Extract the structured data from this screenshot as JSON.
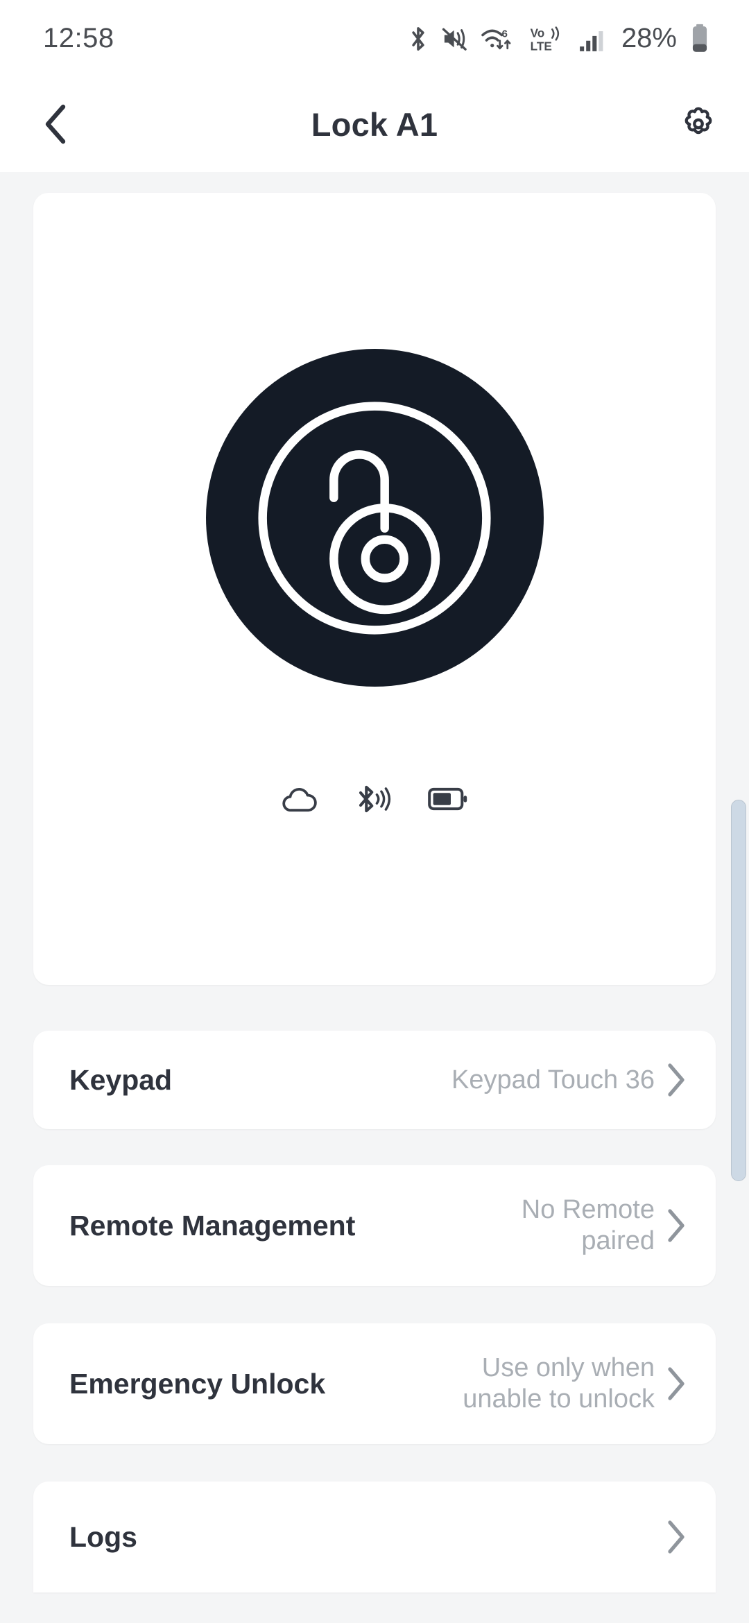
{
  "status_bar": {
    "time": "12:58",
    "battery_percent": "28%",
    "icons": [
      "bluetooth-icon",
      "mute-vibrate-icon",
      "wifi-6-data-icon",
      "volte-icon",
      "cellular-signal-icon",
      "battery-icon"
    ],
    "wifi_generation": "6",
    "network_label_top": "Vo))",
    "network_label_bottom": "LTE"
  },
  "header": {
    "back_icon": "chevron-left-icon",
    "title": "Lock A1",
    "settings_icon": "gear-icon"
  },
  "hero": {
    "lock_state_icon": "unlocked-padlock-icon",
    "circle_color": "#141b26",
    "indicator_icons": [
      "cloud-icon",
      "bluetooth-signal-icon",
      "battery-level-icon"
    ],
    "battery_fill_percent": 70
  },
  "rows": [
    {
      "label": "Keypad",
      "value": "Keypad Touch 36",
      "chevron": "chevron-right-icon"
    },
    {
      "label": "Remote Management",
      "value": "No Remote paired",
      "chevron": "chevron-right-icon"
    },
    {
      "label": "Emergency Unlock",
      "value": "Use only when unable to unlock",
      "chevron": "chevron-right-icon"
    },
    {
      "label": "Logs",
      "value": "",
      "chevron": "chevron-right-icon"
    }
  ],
  "colors": {
    "page_background": "#f4f5f6",
    "card_background": "#ffffff",
    "primary_text": "#2f333d",
    "secondary_text": "#a9aeb4",
    "accent_dark": "#141b26",
    "scrollbar": "#cdd9e5"
  }
}
